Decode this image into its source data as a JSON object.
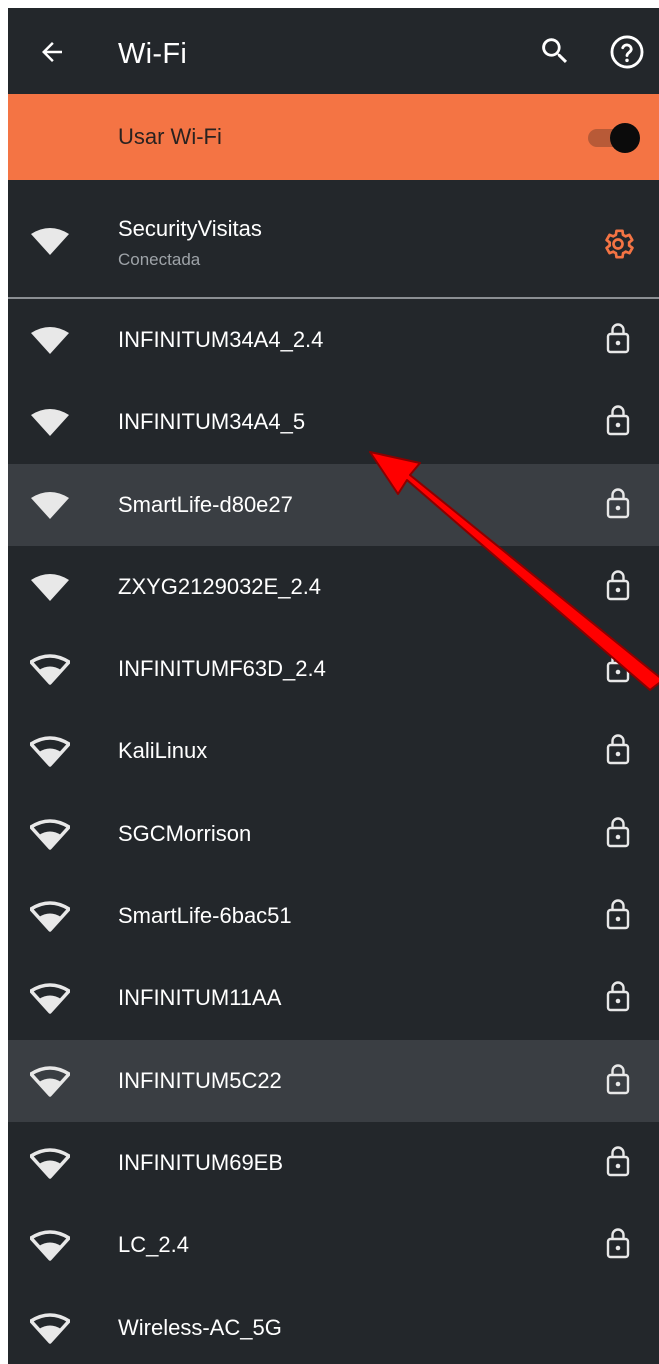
{
  "appbar": {
    "title": "Wi-Fi",
    "back_icon": "arrow-left-icon",
    "search_icon": "search-icon",
    "help_icon": "help-circle-icon"
  },
  "master_switch": {
    "label": "Usar Wi-Fi",
    "enabled": true
  },
  "connected_network": {
    "name": "SecurityVisitas",
    "status": "Conectada",
    "icon": "wifi-full-icon",
    "settings_icon": "gear-icon"
  },
  "networks": [
    {
      "name": "INFINITUM34A4_2.4",
      "signal": "full",
      "secured": true,
      "highlighted": false
    },
    {
      "name": "INFINITUM34A4_5",
      "signal": "full",
      "secured": true,
      "highlighted": false
    },
    {
      "name": "SmartLife-d80e27",
      "signal": "full",
      "secured": true,
      "highlighted": true
    },
    {
      "name": "ZXYG2129032E_2.4",
      "signal": "full",
      "secured": true,
      "highlighted": false
    },
    {
      "name": "INFINITUMF63D_2.4",
      "signal": "medium",
      "secured": true,
      "highlighted": false
    },
    {
      "name": "KaliLinux",
      "signal": "medium",
      "secured": true,
      "highlighted": false
    },
    {
      "name": "SGCMorrison",
      "signal": "medium",
      "secured": true,
      "highlighted": false
    },
    {
      "name": "SmartLife-6bac51",
      "signal": "medium",
      "secured": true,
      "highlighted": false
    },
    {
      "name": "INFINITUM11AA",
      "signal": "medium",
      "secured": true,
      "highlighted": false
    },
    {
      "name": "INFINITUM5C22",
      "signal": "medium",
      "secured": true,
      "highlighted": true
    },
    {
      "name": "INFINITUM69EB",
      "signal": "medium",
      "secured": true,
      "highlighted": false
    },
    {
      "name": "LC_2.4",
      "signal": "medium",
      "secured": true,
      "highlighted": false
    },
    {
      "name": "Wireless-AC_5G",
      "signal": "medium",
      "secured": false,
      "highlighted": false
    }
  ],
  "colors": {
    "background": "#23272b",
    "accent": "#f47444",
    "highlight_row": "#3a3e43",
    "annotation_arrow": "#ff0000"
  },
  "annotation": {
    "type": "arrow",
    "points_to": "INFINITUM34A4_5"
  }
}
